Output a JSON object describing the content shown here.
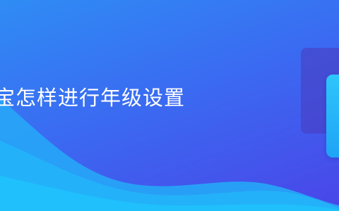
{
  "banner": {
    "title": "宝怎样进行年级设置",
    "colors": {
      "gradient_start": "#2f8cf4",
      "gradient_end": "#4a45e8",
      "wave": "#2aaef8",
      "card_front": "#2ec6fb",
      "card_back": "#483abe",
      "text": "#ffffff"
    }
  }
}
